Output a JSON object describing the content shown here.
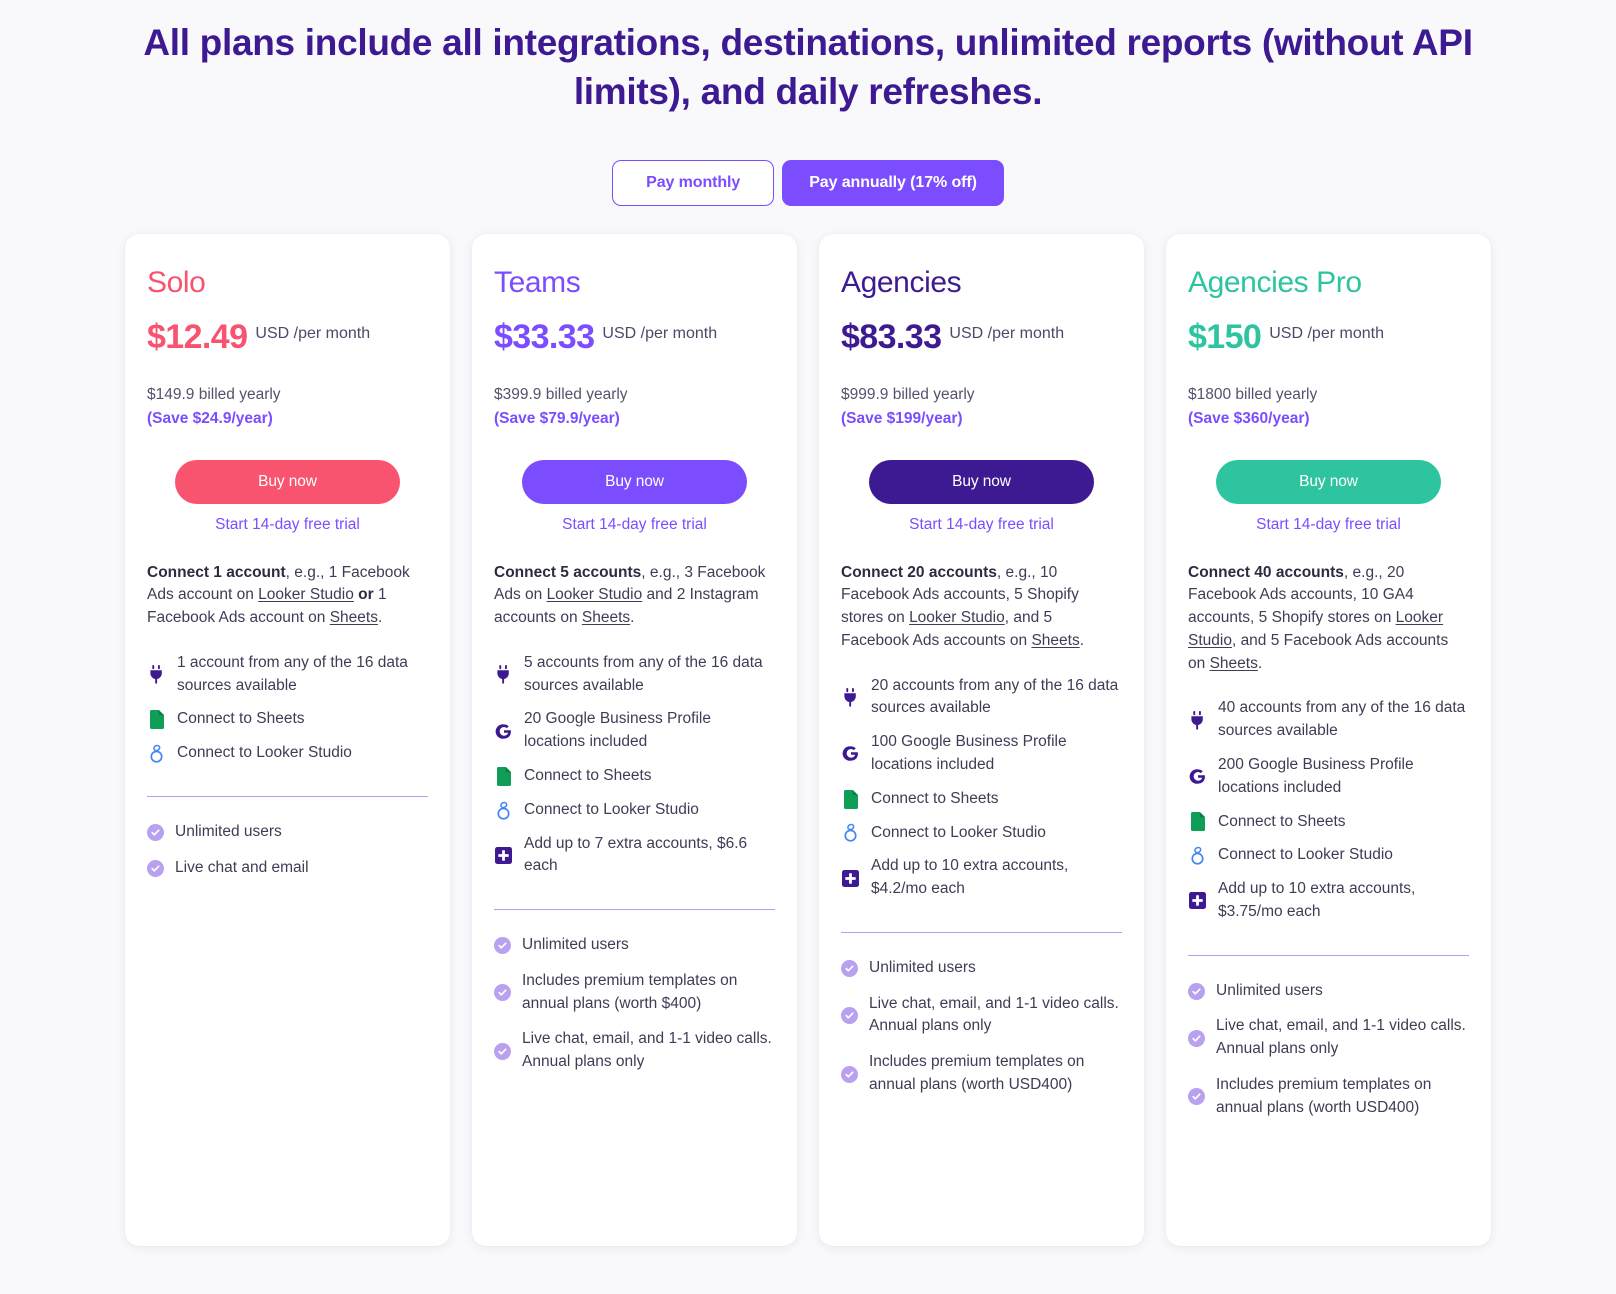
{
  "headline": "All plans include all integrations, destinations, unlimited reports (without API limits), and daily refreshes.",
  "billing_toggle": {
    "monthly_label": "Pay monthly",
    "annual_label": "Pay annually (17% off)",
    "selected": "annual",
    "accent_color": "#7c4dff"
  },
  "common": {
    "price_unit": "USD /per month",
    "buy_label": "Buy now",
    "trial_label": "Start 14-day free trial",
    "sheets_label": "Connect to Sheets",
    "looker_label": "Connect to Looker Studio",
    "unlimited_users": "Unlimited users"
  },
  "plans": [
    {
      "name": "Solo",
      "color": "#f8536f",
      "price": "$12.49",
      "price_unit": "USD /per month",
      "billed": "$149.9 billed yearly",
      "save": "(Save $24.9/year)",
      "buy_label": "Buy now",
      "trial_label": "Start 14-day free trial",
      "desc_bold": "Connect 1 account",
      "desc_rest": ", e.g., 1 Facebook Ads account on ",
      "desc_link1": "Looker Studio",
      "desc_mid": " or 1 Facebook Ads account on ",
      "desc_link2": "Sheets",
      "desc_end": ".",
      "features": [
        {
          "icon": "plug-icon",
          "text": "1 account from any of the 16 data sources available"
        },
        {
          "icon": "sheets-icon",
          "text": "Connect to Sheets"
        },
        {
          "icon": "looker-studio-icon",
          "text": "Connect to Looker Studio"
        }
      ],
      "checks": [
        "Unlimited users",
        "Live chat and email"
      ]
    },
    {
      "name": "Teams",
      "color": "#7c4dff",
      "price": "$33.33",
      "price_unit": "USD /per month",
      "billed": "$399.9 billed yearly",
      "save": "(Save $79.9/year)",
      "buy_label": "Buy now",
      "trial_label": "Start 14-day free trial",
      "desc_bold": "Connect 5 accounts",
      "desc_rest": ", e.g., 3 Facebook Ads on ",
      "desc_link1": "Looker Studio",
      "desc_mid": " and 2 Instagram accounts on ",
      "desc_link2": "Sheets",
      "desc_end": ".",
      "features": [
        {
          "icon": "plug-icon",
          "text": "5 accounts from any of the 16 data sources available"
        },
        {
          "icon": "google-icon",
          "text": "20 Google Business Profile locations included"
        },
        {
          "icon": "sheets-icon",
          "text": "Connect to Sheets"
        },
        {
          "icon": "looker-studio-icon",
          "text": "Connect to Looker Studio"
        },
        {
          "icon": "plus-icon",
          "text": "Add up to 7 extra accounts, $6.6 each"
        }
      ],
      "checks": [
        "Unlimited users",
        "Includes premium templates on annual plans (worth $400)",
        "Live chat, email, and 1-1 video calls. Annual plans only"
      ]
    },
    {
      "name": "Agencies",
      "color": "#3d1a91",
      "price": "$83.33",
      "price_unit": "USD /per month",
      "billed": "$999.9 billed yearly",
      "save": "(Save $199/year)",
      "buy_label": "Buy now",
      "trial_label": "Start 14-day free trial",
      "desc_bold": "Connect 20 accounts",
      "desc_rest": ", e.g., 10 Facebook Ads accounts, 5 Shopify stores on ",
      "desc_link1": "Looker Studio",
      "desc_mid": ", and 5 Facebook Ads accounts on ",
      "desc_link2": "Sheets",
      "desc_end": ".",
      "features": [
        {
          "icon": "plug-icon",
          "text": "20 accounts from any of the 16 data sources available"
        },
        {
          "icon": "google-icon",
          "text": "100 Google Business Profile locations included"
        },
        {
          "icon": "sheets-icon",
          "text": "Connect to Sheets"
        },
        {
          "icon": "looker-studio-icon",
          "text": "Connect to Looker Studio"
        },
        {
          "icon": "plus-icon",
          "text": "Add up to 10 extra accounts, $4.2/mo each"
        }
      ],
      "checks": [
        "Unlimited users",
        "Live chat, email, and 1-1 video calls. Annual plans only",
        "Includes premium templates on annual plans (worth USD400)"
      ]
    },
    {
      "name": "Agencies Pro",
      "color": "#2ec4a0",
      "price": "$150",
      "price_unit": "USD /per month",
      "billed": "$1800 billed yearly",
      "save": "(Save $360/year)",
      "buy_label": "Buy now",
      "trial_label": "Start 14-day free trial",
      "desc_bold": "Connect 40 accounts",
      "desc_rest": ", e.g., 20 Facebook Ads accounts, 10 GA4 accounts,  5 Shopify stores on ",
      "desc_link1": "Looker Studio",
      "desc_mid": ", and 5 Facebook Ads accounts on ",
      "desc_link2": "Sheets",
      "desc_end": ".",
      "features": [
        {
          "icon": "plug-icon",
          "text": "40 accounts from any of the 16 data sources available"
        },
        {
          "icon": "google-icon",
          "text": "200 Google Business Profile locations included"
        },
        {
          "icon": "sheets-icon",
          "text": "Connect to Sheets"
        },
        {
          "icon": "looker-studio-icon",
          "text": "Connect to Looker Studio"
        },
        {
          "icon": "plus-icon",
          "text": "Add up to 10 extra accounts, $3.75/mo each"
        }
      ],
      "checks": [
        "Unlimited users",
        "Live chat, email, and 1-1 video calls. Annual plans only",
        "Includes premium templates on annual plans (worth USD400)"
      ]
    }
  ]
}
